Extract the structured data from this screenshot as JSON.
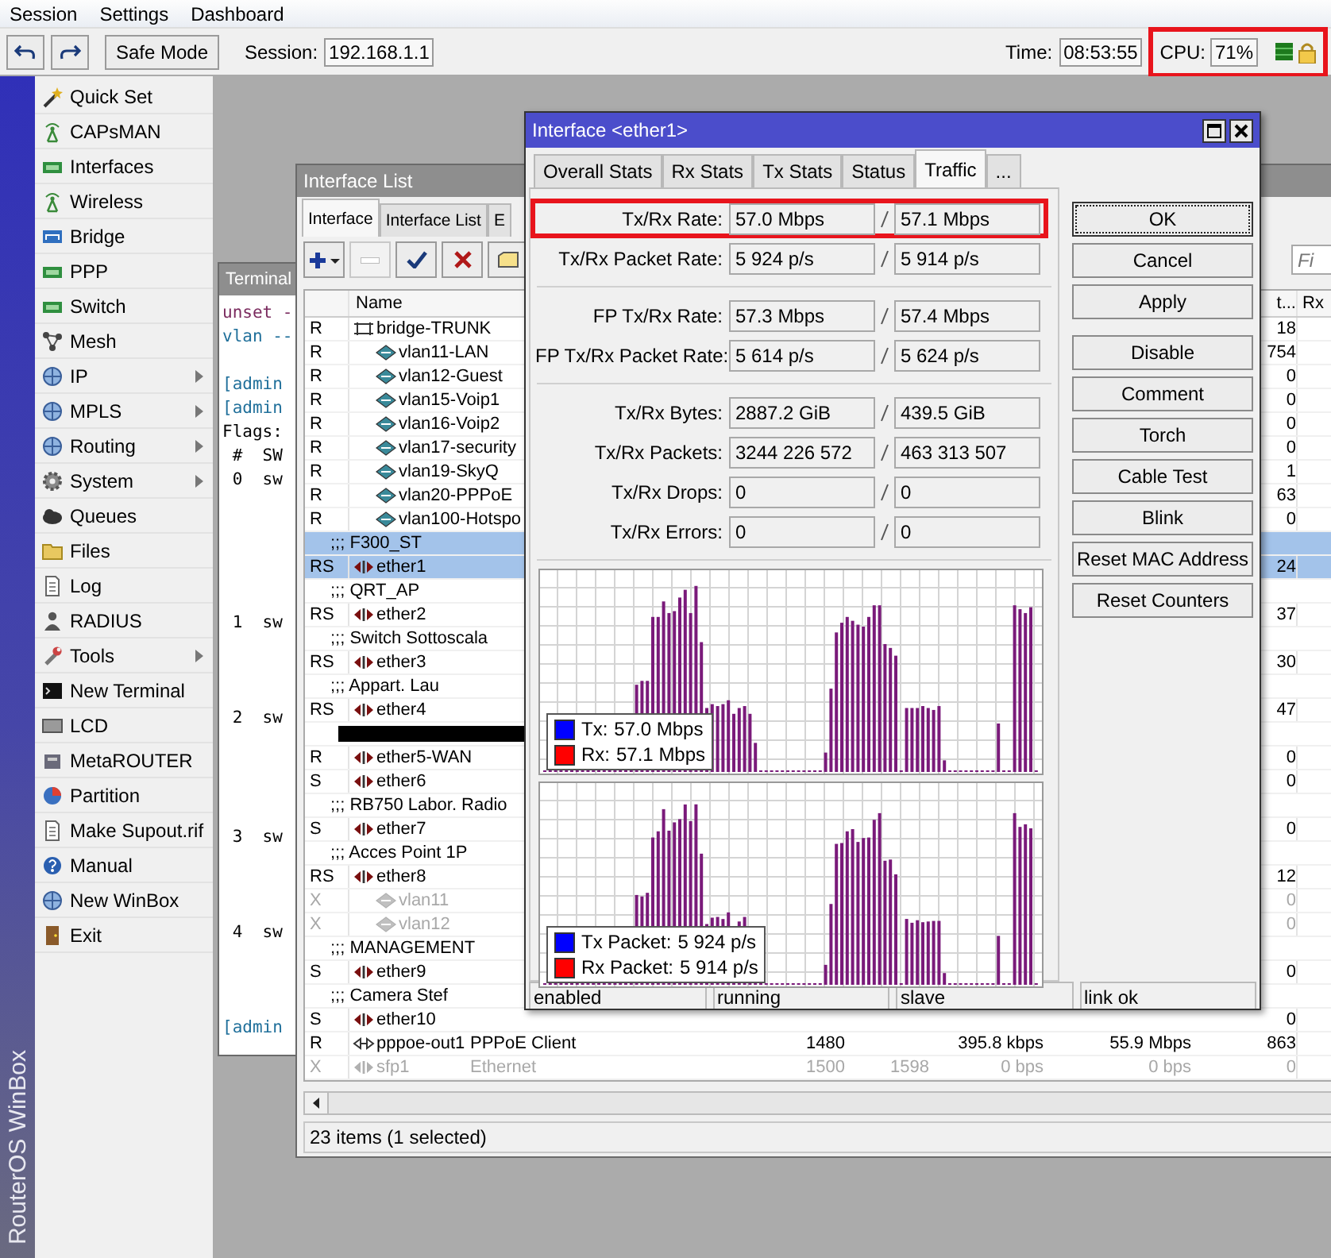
{
  "menu": [
    {
      "label": "Session"
    },
    {
      "label": "Settings"
    },
    {
      "label": "Dashboard"
    }
  ],
  "toolbar": {
    "safe_mode": "Safe Mode",
    "session_label": "Session:",
    "session_value": "192.168.1.1",
    "time_label": "Time:",
    "time_value": "08:53:55",
    "cpu_label": "CPU:",
    "cpu_value": "71%",
    "cpu_highlighted": true
  },
  "brand": "RouterOS WinBox",
  "sidebar": {
    "items": [
      {
        "label": "Quick Set",
        "has_submenu": false
      },
      {
        "label": "CAPsMAN",
        "has_submenu": false
      },
      {
        "label": "Interfaces",
        "has_submenu": false
      },
      {
        "label": "Wireless",
        "has_submenu": false
      },
      {
        "label": "Bridge",
        "has_submenu": false
      },
      {
        "label": "PPP",
        "has_submenu": false
      },
      {
        "label": "Switch",
        "has_submenu": false
      },
      {
        "label": "Mesh",
        "has_submenu": false
      },
      {
        "label": "IP",
        "has_submenu": true
      },
      {
        "label": "MPLS",
        "has_submenu": true
      },
      {
        "label": "Routing",
        "has_submenu": true
      },
      {
        "label": "System",
        "has_submenu": true
      },
      {
        "label": "Queues",
        "has_submenu": false
      },
      {
        "label": "Files",
        "has_submenu": false
      },
      {
        "label": "Log",
        "has_submenu": false
      },
      {
        "label": "RADIUS",
        "has_submenu": false
      },
      {
        "label": "Tools",
        "has_submenu": true
      },
      {
        "label": "New Terminal",
        "has_submenu": false
      },
      {
        "label": "LCD",
        "has_submenu": false
      },
      {
        "label": "MetaROUTER",
        "has_submenu": false
      },
      {
        "label": "Partition",
        "has_submenu": false
      },
      {
        "label": "Make Supout.rif",
        "has_submenu": false
      },
      {
        "label": "Manual",
        "has_submenu": false
      },
      {
        "label": "New WinBox",
        "has_submenu": false
      },
      {
        "label": "Exit",
        "has_submenu": false
      }
    ]
  },
  "terminal": {
    "title": "Terminal",
    "lines": [
      {
        "text": "unset -",
        "color": "#7a2a5e"
      },
      {
        "text": "vlan --",
        "color": "#1f6f9a"
      },
      {
        "text": "[admin",
        "color": "#1f6f9a"
      },
      {
        "text": "[admin",
        "color": "#1f6f9a"
      },
      {
        "text": "Flags:",
        "color": "#000000"
      },
      {
        "text": " #  SW",
        "color": "#000000"
      },
      {
        "text": " 0  sw",
        "color": "#000000"
      },
      {
        "text": " 1  sw",
        "color": "#000000"
      },
      {
        "text": " 2  sw",
        "color": "#000000"
      },
      {
        "text": " 3  sw",
        "color": "#000000"
      },
      {
        "text": " 4  sw",
        "color": "#000000"
      },
      {
        "text": "[admin",
        "color": "#1f6f9a"
      }
    ]
  },
  "interface_list": {
    "title": "Interface List",
    "tabs": [
      {
        "label": "Interface",
        "selected": true
      },
      {
        "label": "Interface List",
        "selected": false
      },
      {
        "label": "E",
        "selected": false
      }
    ],
    "find_placeholder": "Fi",
    "columns": {
      "name": "Name",
      "tx_packet": "t...",
      "rx_packet": "Rx"
    },
    "rows": [
      {
        "kind": "bridge",
        "flags": "R",
        "name": "bridge-TRUNK",
        "selected": false,
        "disabled": false,
        "tx_packet": "18",
        "children": [
          {
            "kind": "vlan",
            "flags": "R",
            "name": "vlan11-LAN",
            "selected": false,
            "disabled": false,
            "tx_packet": "754"
          },
          {
            "kind": "vlan",
            "flags": "R",
            "name": "vlan12-Guest",
            "selected": false,
            "disabled": false,
            "tx_packet": "0"
          },
          {
            "kind": "vlan",
            "flags": "R",
            "name": "vlan15-Voip1",
            "selected": false,
            "disabled": false,
            "tx_packet": "0"
          },
          {
            "kind": "vlan",
            "flags": "R",
            "name": "vlan16-Voip2",
            "selected": false,
            "disabled": false,
            "tx_packet": "0"
          },
          {
            "kind": "vlan",
            "flags": "R",
            "name": "vlan17-security",
            "selected": false,
            "disabled": false,
            "tx_packet": "0"
          },
          {
            "kind": "vlan",
            "flags": "R",
            "name": "vlan19-SkyQ",
            "selected": false,
            "disabled": false,
            "tx_packet": "1"
          },
          {
            "kind": "vlan",
            "flags": "R",
            "name": "vlan20-PPPoE",
            "selected": false,
            "disabled": false,
            "tx_packet": "63"
          },
          {
            "kind": "vlan",
            "flags": "R",
            "name": "vlan100-Hotspo",
            "selected": false,
            "disabled": false,
            "tx_packet": "0"
          }
        ]
      },
      {
        "kind": "comment",
        "text": ";;; F300_ST",
        "selected": true
      },
      {
        "kind": "ether",
        "flags": "RS",
        "name": "ether1",
        "selected": true,
        "disabled": false,
        "tx_packet": "24"
      },
      {
        "kind": "comment",
        "text": ";;; QRT_AP",
        "selected": false
      },
      {
        "kind": "ether",
        "flags": "RS",
        "name": "ether2",
        "selected": false,
        "disabled": false,
        "tx_packet": "37"
      },
      {
        "kind": "comment",
        "text": ";;; Switch Sottoscala",
        "selected": false
      },
      {
        "kind": "ether",
        "flags": "RS",
        "name": "ether3",
        "selected": false,
        "disabled": false,
        "tx_packet": "30"
      },
      {
        "kind": "comment",
        "text": ";;; Appart. Lau",
        "selected": false
      },
      {
        "kind": "ether",
        "flags": "RS",
        "name": "ether4",
        "selected": false,
        "disabled": false,
        "tx_packet": "47"
      },
      {
        "kind": "redacted",
        "selected": false
      },
      {
        "kind": "ether",
        "flags": "R",
        "name": "ether5-WAN",
        "selected": false,
        "disabled": false,
        "tx_packet": "0"
      },
      {
        "kind": "ether",
        "flags": "S",
        "name": "ether6",
        "selected": false,
        "disabled": false,
        "tx_packet": "0"
      },
      {
        "kind": "comment",
        "text": ";;; RB750 Labor. Radio",
        "selected": false
      },
      {
        "kind": "ether",
        "flags": "S",
        "name": "ether7",
        "selected": false,
        "disabled": false,
        "tx_packet": "0"
      },
      {
        "kind": "comment",
        "text": ";;; Acces Point 1P",
        "selected": false
      },
      {
        "kind": "ether",
        "flags": "RS",
        "name": "ether8",
        "selected": false,
        "disabled": false,
        "tx_packet": "12",
        "children": [
          {
            "kind": "vlan",
            "flags": "X",
            "name": "vlan11",
            "selected": false,
            "disabled": true,
            "tx_packet": "0"
          },
          {
            "kind": "vlan",
            "flags": "X",
            "name": "vlan12",
            "selected": false,
            "disabled": true,
            "tx_packet": "0"
          }
        ]
      },
      {
        "kind": "comment",
        "text": ";;; MANAGEMENT",
        "selected": false
      },
      {
        "kind": "ether",
        "flags": "S",
        "name": "ether9",
        "selected": false,
        "disabled": false,
        "tx_packet": "0"
      },
      {
        "kind": "comment",
        "text": ";;; Camera Stef",
        "selected": false
      },
      {
        "kind": "ether",
        "flags": "S",
        "name": "ether10",
        "selected": false,
        "disabled": false,
        "tx_packet": "0"
      },
      {
        "kind": "pppoe",
        "flags": "R",
        "name": "pppoe-out1",
        "selected": false,
        "disabled": false,
        "type": "PPPoE Client",
        "mtu": "1480",
        "tx": "395.8 kbps",
        "rx": "55.9 Mbps",
        "tx_packet": "863"
      },
      {
        "kind": "ether",
        "flags": "X",
        "name": "sfp1",
        "selected": false,
        "disabled": true,
        "type": "Ethernet",
        "mtu": "1500",
        "l2mtu": "1598",
        "tx": "0 bps",
        "rx": "0 bps",
        "tx_packet": "0"
      }
    ],
    "status": "23 items (1 selected)"
  },
  "dialog": {
    "title": "Interface <ether1>",
    "tabs": [
      {
        "label": "Overall Stats",
        "selected": false
      },
      {
        "label": "Rx Stats",
        "selected": false
      },
      {
        "label": "Tx Stats",
        "selected": false
      },
      {
        "label": "Status",
        "selected": false
      },
      {
        "label": "Traffic",
        "selected": true
      },
      {
        "label": "...",
        "selected": false
      }
    ],
    "stat_groups": [
      {
        "rows": [
          {
            "label": "Tx/Rx Rate:",
            "tx": "57.0 Mbps",
            "rx": "57.1 Mbps",
            "highlighted": true
          },
          {
            "label": "Tx/Rx Packet Rate:",
            "tx": "5 924 p/s",
            "rx": "5 914 p/s",
            "highlighted": false
          }
        ]
      },
      {
        "rows": [
          {
            "label": "FP Tx/Rx Rate:",
            "tx": "57.3 Mbps",
            "rx": "57.4 Mbps",
            "highlighted": false
          },
          {
            "label": "FP Tx/Rx Packet Rate:",
            "tx": "5 614 p/s",
            "rx": "5 624 p/s",
            "highlighted": false
          }
        ]
      },
      {
        "rows": [
          {
            "label": "Tx/Rx Bytes:",
            "tx": "2887.2 GiB",
            "rx": "439.5 GiB",
            "highlighted": false
          },
          {
            "label": "Tx/Rx Packets:",
            "tx": "3244 226 572",
            "rx": "463 313 507",
            "highlighted": false
          },
          {
            "label": "Tx/Rx Drops:",
            "tx": "0",
            "rx": "0",
            "highlighted": false
          },
          {
            "label": "Tx/Rx Errors:",
            "tx": "0",
            "rx": "0",
            "highlighted": false
          }
        ]
      }
    ],
    "charts": [
      {
        "legend": [
          {
            "label": "Tx:",
            "value": "57.0 Mbps",
            "color": "#0000ff"
          },
          {
            "label": "Rx:",
            "value": "57.1 Mbps",
            "color": "#ff0000"
          }
        ]
      },
      {
        "legend": [
          {
            "label": "Tx Packet:",
            "value": "5 924 p/s",
            "color": "#0000ff"
          },
          {
            "label": "Rx Packet:",
            "value": "5 914 p/s",
            "color": "#ff0000"
          }
        ]
      }
    ],
    "button_groups": [
      {
        "buttons": [
          {
            "label": "OK",
            "focused": true
          },
          {
            "label": "Cancel",
            "focused": false
          },
          {
            "label": "Apply",
            "focused": false
          }
        ]
      },
      {
        "buttons": [
          {
            "label": "Disable",
            "focused": false
          },
          {
            "label": "Comment",
            "focused": false
          },
          {
            "label": "Torch",
            "focused": false
          },
          {
            "label": "Cable Test",
            "focused": false
          },
          {
            "label": "Blink",
            "focused": false
          },
          {
            "label": "Reset MAC Address",
            "focused": false
          },
          {
            "label": "Reset Counters",
            "focused": false
          }
        ]
      }
    ],
    "status": [
      "enabled",
      "running",
      "slave",
      "link ok"
    ]
  }
}
